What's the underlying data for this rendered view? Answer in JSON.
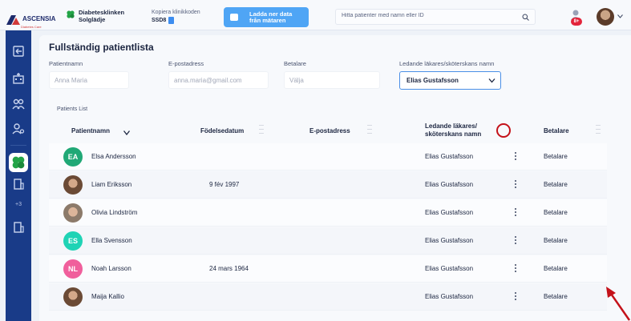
{
  "header": {
    "brand_name": "ASCENSIA",
    "brand_sub": "Diabetes Care",
    "clinic_line1": "Diabetesklinken",
    "clinic_line2": "Solglädje",
    "copy_label": "Kopiera klinikkoden",
    "clinic_code": "SSD8",
    "upload_label": "Ladda ner data från mätaren",
    "search_placeholder": "Hitta patienter med namn eller ID",
    "notification_badge": "8+"
  },
  "sidebar": {
    "more_label": "+3"
  },
  "page": {
    "title": "Fullständig patientlista",
    "filters": {
      "name_label": "Patientnamn",
      "name_placeholder": "Anna Maria",
      "email_label": "E-postadress",
      "email_placeholder": "anna.maria@gmail.com",
      "payer_label": "Betalare",
      "payer_placeholder": "Välja",
      "doctor_label": "Ledande läkares/sköterskans namn",
      "doctor_value": "Elias Gustafsson"
    },
    "list_label": "Patients List",
    "columns": {
      "name": "Patientnamn",
      "dob": "Födelsedatum",
      "email": "E-postadress",
      "doctor_line1": "Ledande läkares/",
      "doctor_line2": "sköterskans namn",
      "payer": "Betalare"
    },
    "rows": [
      {
        "initials": "EA",
        "color": "#20a876",
        "name": "Elsa Andersson",
        "dob": "",
        "doctor": "Elias Gustafsson",
        "payer": "Betalare"
      },
      {
        "initials": "",
        "color": "",
        "name": "Liam Eriksson",
        "dob": "9 fév 1997",
        "doctor": "Elias Gustafsson",
        "payer": "Betalare"
      },
      {
        "initials": "",
        "color": "",
        "name": "Olivia Lindström",
        "dob": "",
        "doctor": "Elias Gustafsson",
        "payer": "Betalare"
      },
      {
        "initials": "ES",
        "color": "#1fd3b5",
        "name": "Ella Svensson",
        "dob": "",
        "doctor": "Elias Gustafsson",
        "payer": "Betalare"
      },
      {
        "initials": "NL",
        "color": "#f05f9c",
        "name": "Noah Larsson",
        "dob": "24 mars 1964",
        "doctor": "Elias Gustafsson",
        "payer": "Betalare"
      },
      {
        "initials": "",
        "color": "",
        "name": "Maija Kallio",
        "dob": "",
        "doctor": "Elias Gustafsson",
        "payer": "Betalare"
      }
    ]
  }
}
